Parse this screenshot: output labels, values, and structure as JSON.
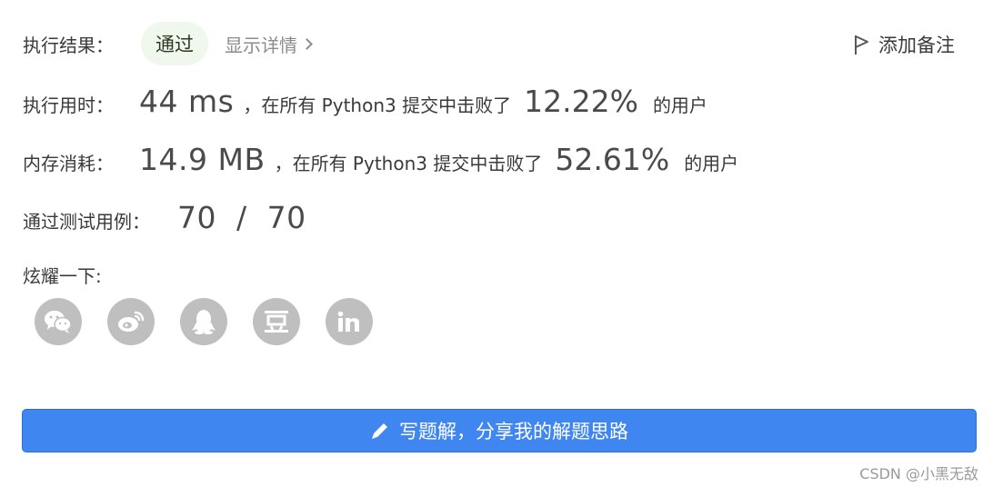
{
  "result": {
    "label": "执行结果：",
    "status": "通过",
    "details_link": "显示详情",
    "add_note": "添加备注"
  },
  "runtime": {
    "label": "执行用时：",
    "value": "44 ms",
    "text_before": "，在所有 Python3 提交中击败了",
    "percent": "12.22%",
    "text_after": "的用户"
  },
  "memory": {
    "label": "内存消耗：",
    "value": "14.9 MB",
    "text_before": "，在所有 Python3 提交中击败了",
    "percent": "52.61%",
    "text_after": "的用户"
  },
  "test_cases": {
    "label": "通过测试用例：",
    "value": "70  /  70"
  },
  "share": {
    "label": "炫耀一下:",
    "icons": [
      "wechat-icon",
      "weibo-icon",
      "qq-icon",
      "douban-icon",
      "linkedin-icon"
    ]
  },
  "cta": {
    "label": "写题解，分享我的解题思路"
  },
  "watermark": "CSDN @小黑无敌",
  "colors": {
    "accent": "#3f86f0",
    "badge_bg": "#f0f7ec",
    "icon_gray": "#bfbfbf"
  }
}
